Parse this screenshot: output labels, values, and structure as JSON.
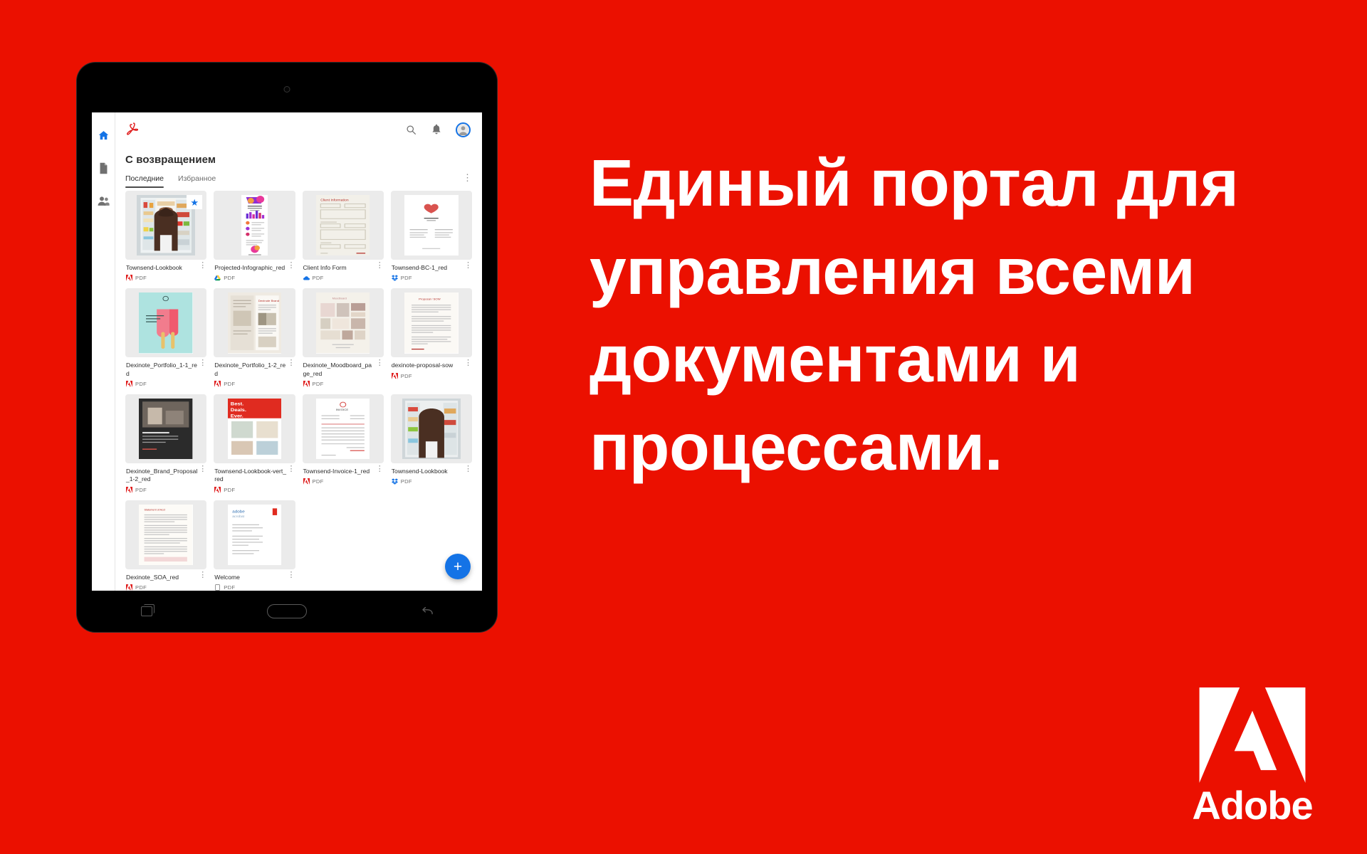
{
  "brand": {
    "red": "#EB1000",
    "blue": "#1473E6",
    "name": "Adobe"
  },
  "headline": {
    "lines": [
      "Единый портал для",
      "управления всеми",
      "документами и",
      "процессами."
    ]
  },
  "tablet": {
    "nav": {
      "recents_label": "recents",
      "home_label": "home",
      "back_label": "back"
    }
  },
  "app": {
    "logo_name": "acrobat-logo",
    "rail": [
      {
        "name": "home-icon",
        "label": "Home",
        "active": true
      },
      {
        "name": "files-icon",
        "label": "Files",
        "active": false
      },
      {
        "name": "shared-icon",
        "label": "Shared",
        "active": false
      }
    ],
    "topbar": {
      "search_label": "Search",
      "notifications_label": "Notifications",
      "account_label": "Account"
    },
    "title": "С возвращением",
    "tabs": [
      {
        "label": "Последние",
        "active": true
      },
      {
        "label": "Избранное",
        "active": false
      }
    ],
    "overflow_label": "⋮",
    "fab_label": "+",
    "files": [
      {
        "name": "Townsend-Lookbook",
        "source": "adobe",
        "type": "PDF",
        "starred": true,
        "art": "fridge"
      },
      {
        "name": "Projected-Infographic_red",
        "source": "gdrive",
        "type": "PDF",
        "starred": false,
        "art": "infographic"
      },
      {
        "name": "Client Info Form",
        "source": "onedrive",
        "type": "PDF",
        "starred": false,
        "art": "form"
      },
      {
        "name": "Townsend-BC-1_red",
        "source": "dropbox",
        "type": "PDF",
        "starred": false,
        "art": "card"
      },
      {
        "name": "Dexinote_Portfolio_1-1_red",
        "source": "adobe",
        "type": "PDF",
        "starred": false,
        "art": "popsicle"
      },
      {
        "name": "Dexinote_Portfolio_1-2_red",
        "source": "adobe",
        "type": "PDF",
        "starred": false,
        "art": "spread"
      },
      {
        "name": "Dexinote_Moodboard_page_red",
        "source": "adobe",
        "type": "PDF",
        "starred": false,
        "art": "moodboard"
      },
      {
        "name": "dexinote-proposal-sow",
        "source": "adobe",
        "type": "PDF",
        "starred": false,
        "art": "proposal"
      },
      {
        "name": "Dexinote_Brand_Proposal_1-2_red",
        "source": "adobe",
        "type": "PDF",
        "starred": false,
        "art": "darkphoto"
      },
      {
        "name": "Townsend-Lookbook-vert_red",
        "source": "adobe",
        "type": "PDF",
        "starred": false,
        "art": "bestdeals"
      },
      {
        "name": "Townsend-Invoice-1_red",
        "source": "adobe",
        "type": "PDF",
        "starred": false,
        "art": "invoice"
      },
      {
        "name": "Townsend-Lookbook",
        "source": "dropbox",
        "type": "PDF",
        "starred": false,
        "art": "hair"
      },
      {
        "name": "Dexinote_SOA_red",
        "source": "adobe",
        "type": "PDF",
        "starred": false,
        "art": "soa"
      },
      {
        "name": "Welcome",
        "source": "device",
        "type": "PDF",
        "starred": false,
        "art": "welcome"
      }
    ]
  }
}
